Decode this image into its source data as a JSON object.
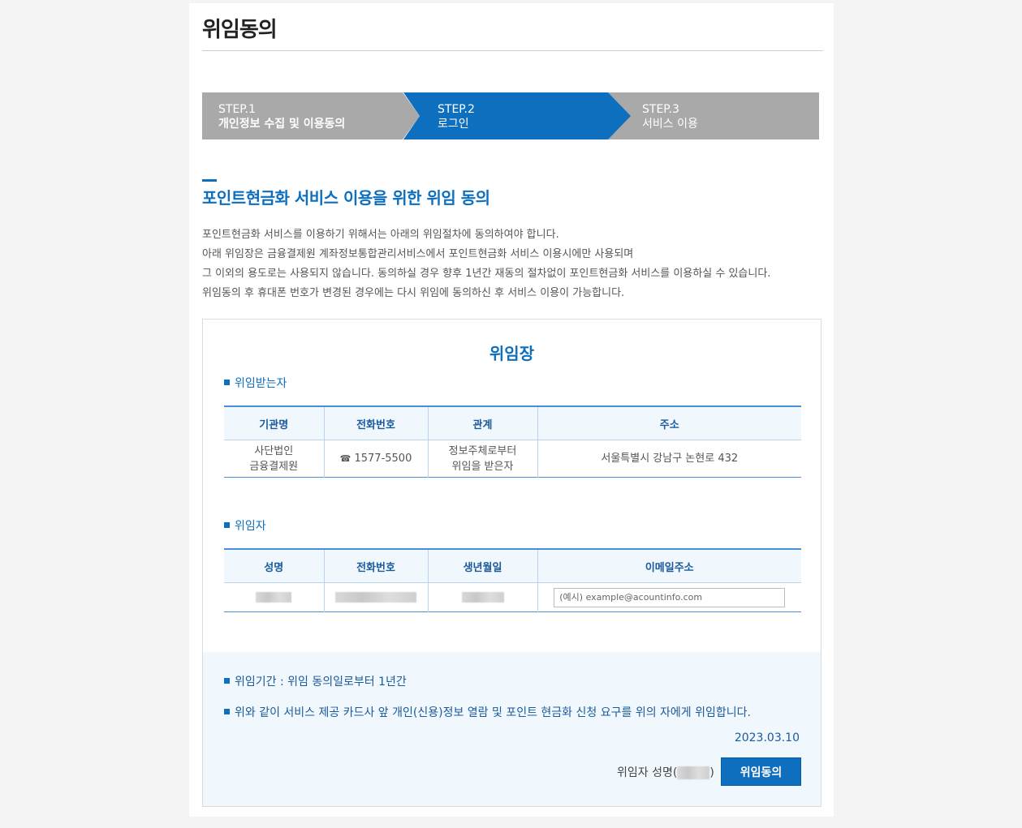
{
  "page": {
    "title": "위임동의"
  },
  "steps": [
    {
      "num": "STEP.1",
      "label": "개인정보 수집 및 이용동의"
    },
    {
      "num": "STEP.2",
      "label": "로그인"
    },
    {
      "num": "STEP.3",
      "label": "서비스 이용"
    }
  ],
  "section": {
    "title": "포인트현금화 서비스 이용을 위한 위임 동의",
    "intro": [
      "포인트현금화 서비스를 이용하기 위해서는 아래의 위임절차에 동의하여야 합니다.",
      "아래 위임장은 금융결제원 계좌정보통합관리서비스에서 포인트현금화 서비스 이용시에만 사용되며",
      "그 이외의 용도로는 사용되지 않습니다. 동의하실 경우 향후 1년간 재동의 절차없이 포인트현금화 서비스를 이용하실 수 있습니다.",
      "위임동의 후 휴대폰 번호가 변경된 경우에는 다시 위임에 동의하신 후 서비스 이용이 가능합니다."
    ]
  },
  "proxy": {
    "title": "위임장",
    "receiver": {
      "label": "위임받는자",
      "headers": [
        "기관명",
        "전화번호",
        "관계",
        "주소"
      ],
      "org_line1": "사단법인",
      "org_line2": "금융결제원",
      "phone_icon": "☎",
      "phone": "1577-5500",
      "relation_line1": "정보주체로부터",
      "relation_line2": "위임을 받은자",
      "address": "서울특별시 강남구 논현로 432"
    },
    "delegator": {
      "label": "위임자",
      "headers": [
        "성명",
        "전화번호",
        "생년월일",
        "이메일주소"
      ],
      "email_placeholder": "(예시) example@acountinfo.com"
    },
    "period": "위임기간 : 위임 동의일로부터 1년간",
    "statement": "위와 같이 서비스 제공 카드사 앞 개인(신용)정보 열람 및 포인트 현금화 신청 요구를 위의 자에게 위임합니다.",
    "date": "2023.03.10",
    "signer_prefix": "위임자 성명(",
    "signer_suffix": ")",
    "agree_button": "위임동의"
  }
}
